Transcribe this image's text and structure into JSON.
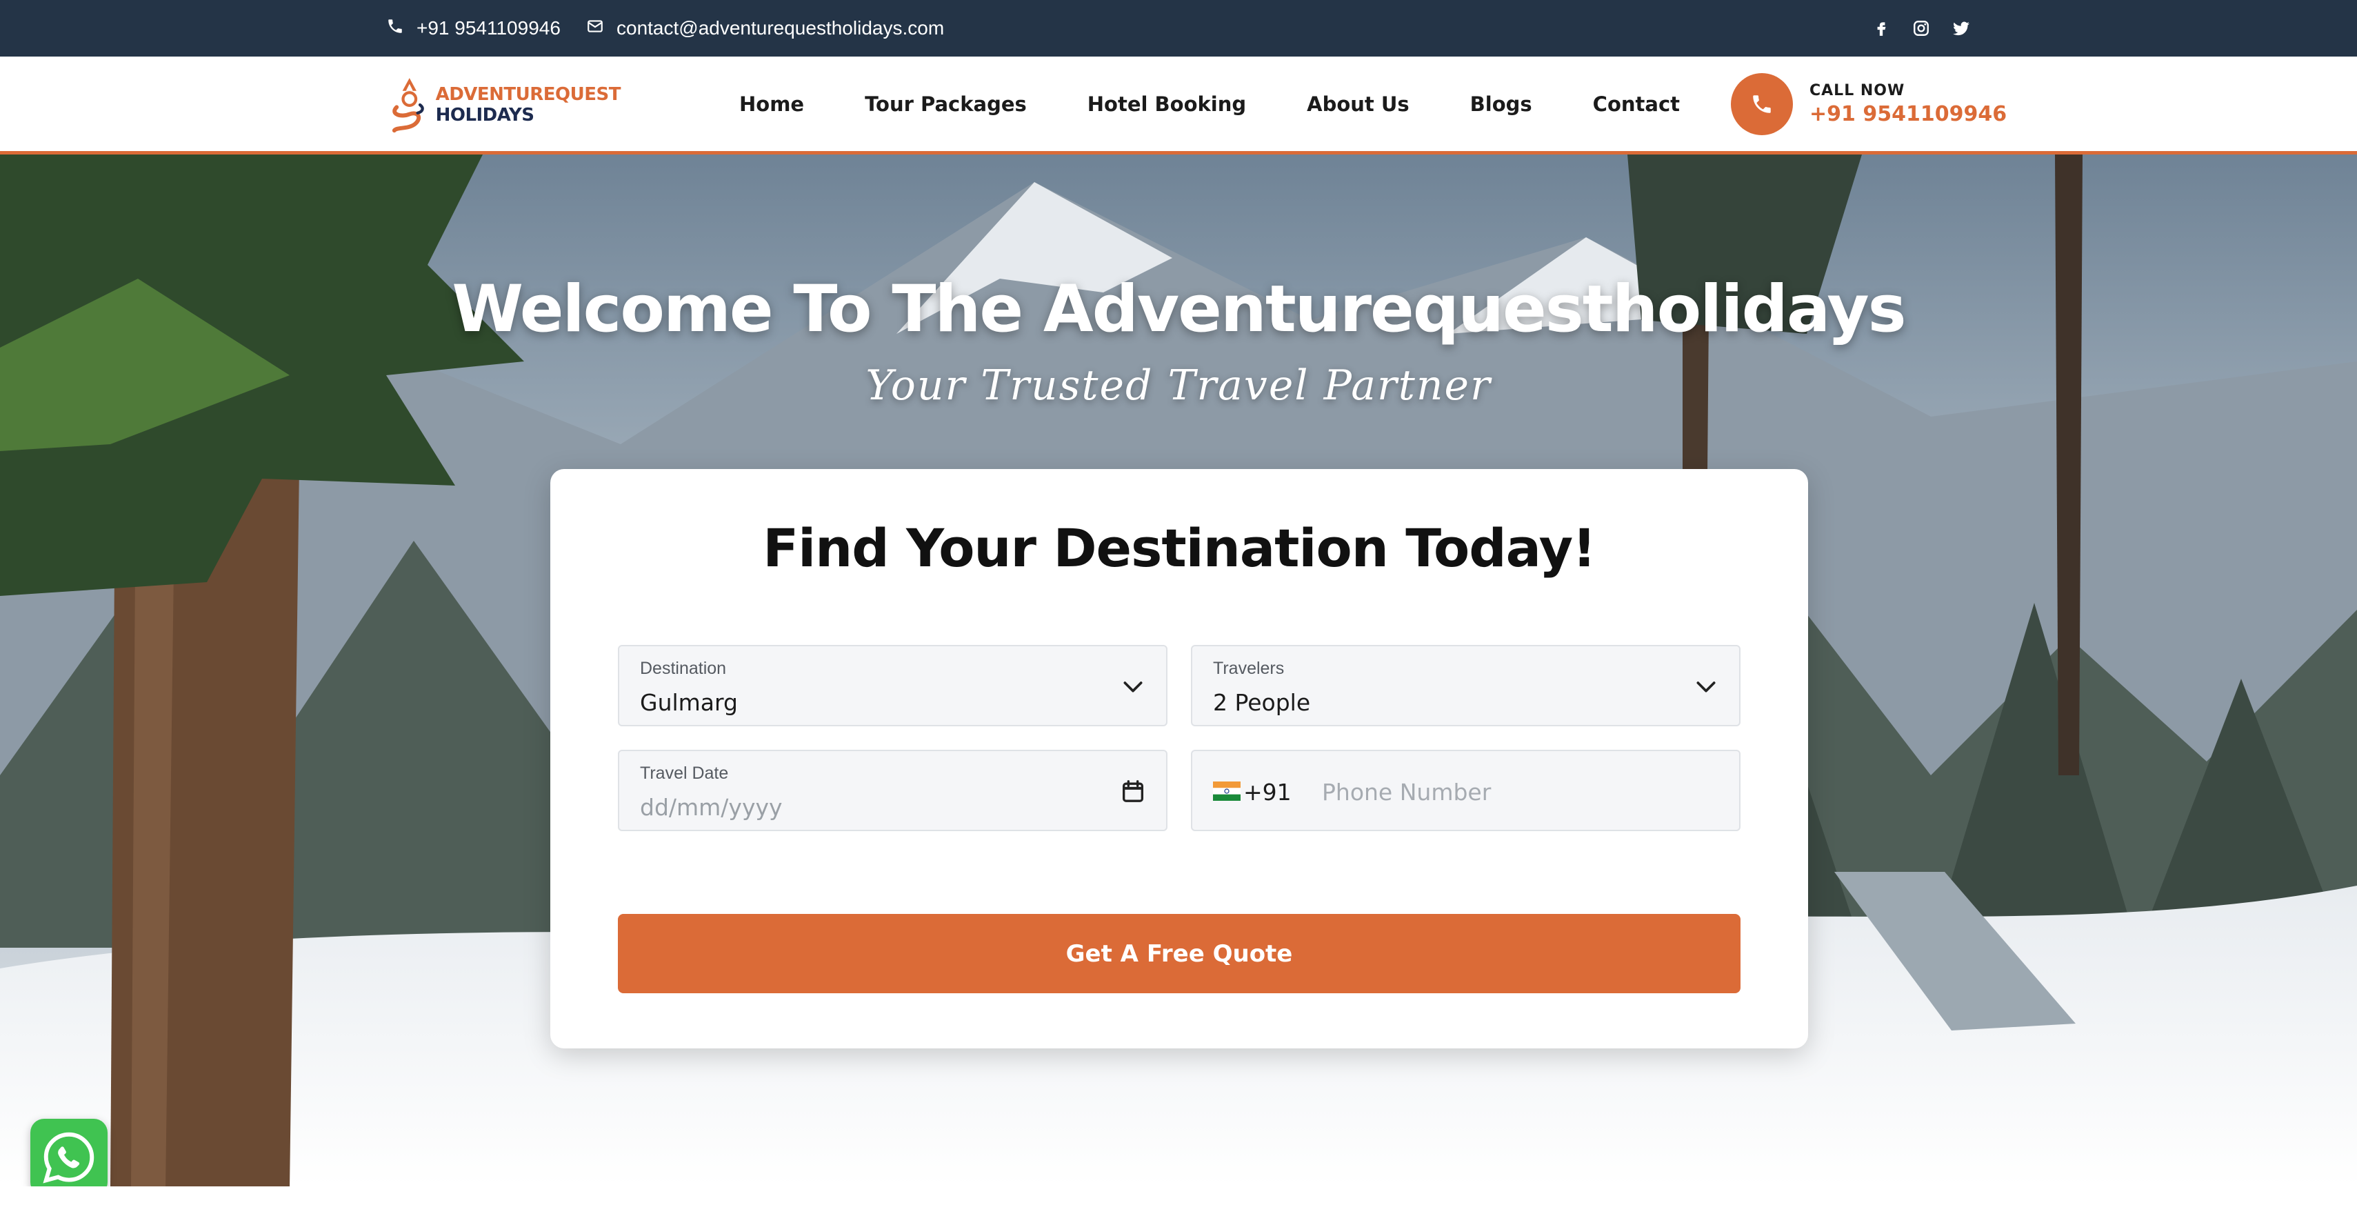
{
  "topbar": {
    "phone": "+91 9541109946",
    "email": "contact@adventurequestholidays.com",
    "socials": [
      "facebook-icon",
      "instagram-icon",
      "twitter-icon"
    ]
  },
  "header": {
    "logo_line1": "ADVENTUREQUEST",
    "logo_line2": "HOLIDAYS",
    "nav": [
      "Home",
      "Tour Packages",
      "Hotel Booking",
      "About Us",
      "Blogs",
      "Contact"
    ],
    "call_label": "CALL NOW",
    "call_number": "+91 9541109946"
  },
  "hero": {
    "title": "Welcome To The Adventurequestholidays",
    "subtitle": "Your Trusted Travel Partner"
  },
  "form": {
    "title": "Find Your Destination Today!",
    "destination": {
      "label": "Destination",
      "value": "Gulmarg"
    },
    "travelers": {
      "label": "Travelers",
      "value": "2 People"
    },
    "travel_date": {
      "label": "Travel Date",
      "placeholder": "dd/mm/yyyy"
    },
    "phone": {
      "country_code": "+91",
      "placeholder": "Phone Number"
    },
    "submit_label": "Get A Free Quote"
  },
  "colors": {
    "accent": "#db6b37",
    "topbar": "#243447",
    "whatsapp": "#40c351"
  }
}
